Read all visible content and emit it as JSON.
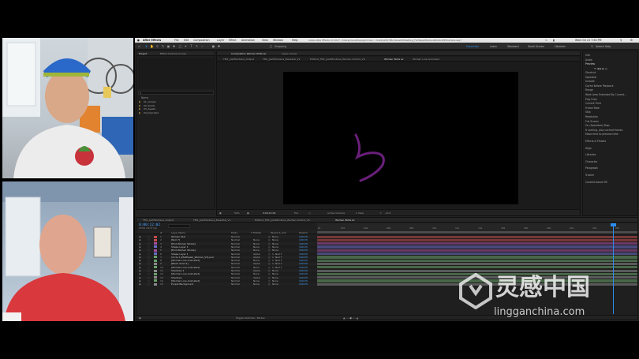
{
  "menubar": {
    "app_name": "After Effects",
    "items": [
      "File",
      "Edit",
      "Composition",
      "Layer",
      "Effect",
      "Animation",
      "View",
      "Window",
      "Help"
    ],
    "title": "Adobe After Effects CC 2017 - /Users/jmorell/Google Drive/... Clients/2017/MontenaWithGetting_Fix/Maps/MontenaMotionWithCamera.aep *",
    "clock": "Wed Oct 21  7:50 PM"
  },
  "toolbar": {
    "snapping_label": "Snapping",
    "search_placeholder": "Search Help",
    "workspaces": [
      "Essentials",
      "Learn",
      "Standard",
      "Small Screen",
      "Libraries"
    ]
  },
  "project_panel": {
    "tabs": [
      "Project",
      "Effect Controls (none)"
    ],
    "search_placeholder": "",
    "column_header": "Name",
    "items": [
      "01_Comps",
      "02_Solids",
      "03_Assets",
      "04_Imported"
    ]
  },
  "comp_panel": {
    "top_tabs": [
      "Composition Woman Write Gr",
      "Layer (none)"
    ],
    "breadcrumbs": [
      "TM1_JoshMontena_Output",
      "TM1_JoshMontena_Essential_V1",
      "EditCut_TM1_JoshMontena_Woman Control_V4",
      "Woman Write Gr",
      "Woman Line Animated"
    ],
    "zoom": "50%",
    "timecode": "0;00;12;02",
    "resolution": "Full",
    "camera": "Active Camera",
    "views": "1 View",
    "offset": "+0.0"
  },
  "timeline": {
    "tabs": [
      "TM1_JoshMontena_Output",
      "TM1_JoshMontena_Essential_V1",
      "EditCut_TM1_JoshMontena_Woman Control_V4",
      "Woman Write Gr"
    ],
    "timecode": "0;00;12;02",
    "fps_label": "00362 (29.97 fps)",
    "column_headers": [
      "#",
      "Layer Name",
      "Mode",
      "T TrkMat",
      "Parent & Link",
      "Stretch"
    ],
    "layers": [
      {
        "num": "1",
        "name": "Woman Null",
        "mode": "Normal",
        "trk": "",
        "parent": "None",
        "stretch": "100.0%",
        "color": "#c04a4a"
      },
      {
        "num": "2",
        "name": "[Null 7]",
        "mode": "Normal",
        "trk": "None",
        "parent": "None",
        "stretch": "100.0%",
        "color": "#c04a4a"
      },
      {
        "num": "3",
        "name": "[End Woman Stroke]",
        "mode": "Normal",
        "trk": "None",
        "parent": "None",
        "stretch": "100.0%",
        "color": "#a84e9e"
      },
      {
        "num": "4",
        "name": "Shape Layer 1",
        "mode": "Normal",
        "trk": "None",
        "parent": "None",
        "stretch": "100.0%",
        "color": "#6c6cc8"
      },
      {
        "num": "5",
        "name": "[End Woman Stroke]",
        "mode": "Normal",
        "trk": "None",
        "parent": "None",
        "stretch": "100.0%",
        "color": "#a84e9e"
      },
      {
        "num": "6",
        "name": "Shape Layer 1",
        "mode": "Normal",
        "trk": "Alpha",
        "parent": "1. Null 7",
        "stretch": "100.0%",
        "color": "#6c6cc8"
      },
      {
        "num": "7",
        "name": "Circle 1 (Matthews_Woman_V3).psd",
        "mode": "Normal",
        "trk": "Alpha",
        "parent": "1. Null 7",
        "stretch": "100.0%",
        "color": "#6aa06a"
      },
      {
        "num": "8",
        "name": "[Woman Line Animated]",
        "mode": "Normal",
        "trk": "None",
        "parent": "1. Null 7",
        "stretch": "100.0%",
        "color": "#6aa06a"
      },
      {
        "num": "9",
        "name": "[Black Solid 1]",
        "mode": "Normal",
        "trk": "Alpha",
        "parent": "1. Null 7",
        "stretch": "100.0%",
        "color": "#8a8a8a"
      },
      {
        "num": "10",
        "name": "[Woman Line Animated]",
        "mode": "Normal",
        "trk": "None",
        "parent": "1. Null 7",
        "stretch": "100.0%",
        "color": "#6aa06a"
      },
      {
        "num": "11",
        "name": "Shadows 1",
        "mode": "Normal",
        "trk": "Alpha",
        "parent": "None",
        "stretch": "100.0%",
        "color": "#8a8a8a"
      },
      {
        "num": "12",
        "name": "[Woman Line Animated]",
        "mode": "Normal",
        "trk": "None",
        "parent": "None",
        "stretch": "100.0%",
        "color": "#6aa06a"
      },
      {
        "num": "13",
        "name": "Shadows",
        "mode": "Normal",
        "trk": "Alpha",
        "parent": "None",
        "stretch": "100.0%",
        "color": "#8a8a8a"
      },
      {
        "num": "14",
        "name": "[Woman Line Animated]",
        "mode": "Normal",
        "trk": "None",
        "parent": "None",
        "stretch": "100.0%",
        "color": "#6aa06a"
      },
      {
        "num": "15",
        "name": "Purple Background",
        "mode": "Normal",
        "trk": "None",
        "parent": "None",
        "stretch": "100.0%",
        "color": "#8a8a8a"
      }
    ],
    "ruler_ticks": [
      "0s",
      "02s",
      "04s",
      "06s",
      "08s",
      "10s",
      "12s",
      "14s",
      "16s",
      "18s",
      "20s",
      "22s",
      "24s",
      "26s"
    ],
    "footer_label": "Toggle Switches / Modes"
  },
  "right_panel": {
    "sections": [
      {
        "label": "Info",
        "header": false
      },
      {
        "label": "Audio",
        "header": false
      },
      {
        "label": "Preview",
        "header": true
      },
      {
        "label": "Shortcut",
        "header": false
      },
      {
        "label": "Spacebar",
        "header": false
      },
      {
        "label": "Include:",
        "header": false
      },
      {
        "label": "Cache Before Playback",
        "header": false
      },
      {
        "label": "Range",
        "header": false
      },
      {
        "label": "Work Area Extended By Current...",
        "header": false
      },
      {
        "label": "Play From",
        "header": false
      },
      {
        "label": "Current Time",
        "header": false
      },
      {
        "label": "Frame Rate",
        "header": false
      },
      {
        "label": "Skip",
        "header": false
      },
      {
        "label": "Resolution",
        "header": false
      },
      {
        "label": "Full Screen",
        "header": false
      },
      {
        "label": "On (Spacebar) Stop:",
        "header": false
      },
      {
        "label": "If caching, play cached frames",
        "header": false
      },
      {
        "label": "Move time to preview time",
        "header": false
      },
      {
        "label": "Effects & Presets",
        "header": false
      },
      {
        "label": "Align",
        "header": false
      },
      {
        "label": "Libraries",
        "header": false
      },
      {
        "label": "Character",
        "header": false
      },
      {
        "label": "Paragraph",
        "header": false
      },
      {
        "label": "Tracker",
        "header": false
      },
      {
        "label": "Content-Aware Fill",
        "header": false
      }
    ],
    "frame_rate_value": "(29.97)",
    "skip_value": "0",
    "resolution_value": "Auto"
  },
  "watermark": {
    "logo_text": "灵感中国",
    "url_text": "lingganchina.com"
  },
  "colors": {
    "accent_blue": "#2d8ceb",
    "stroke_purple": "#6a1f7a",
    "timecode_blue": "#4aa3ff"
  }
}
